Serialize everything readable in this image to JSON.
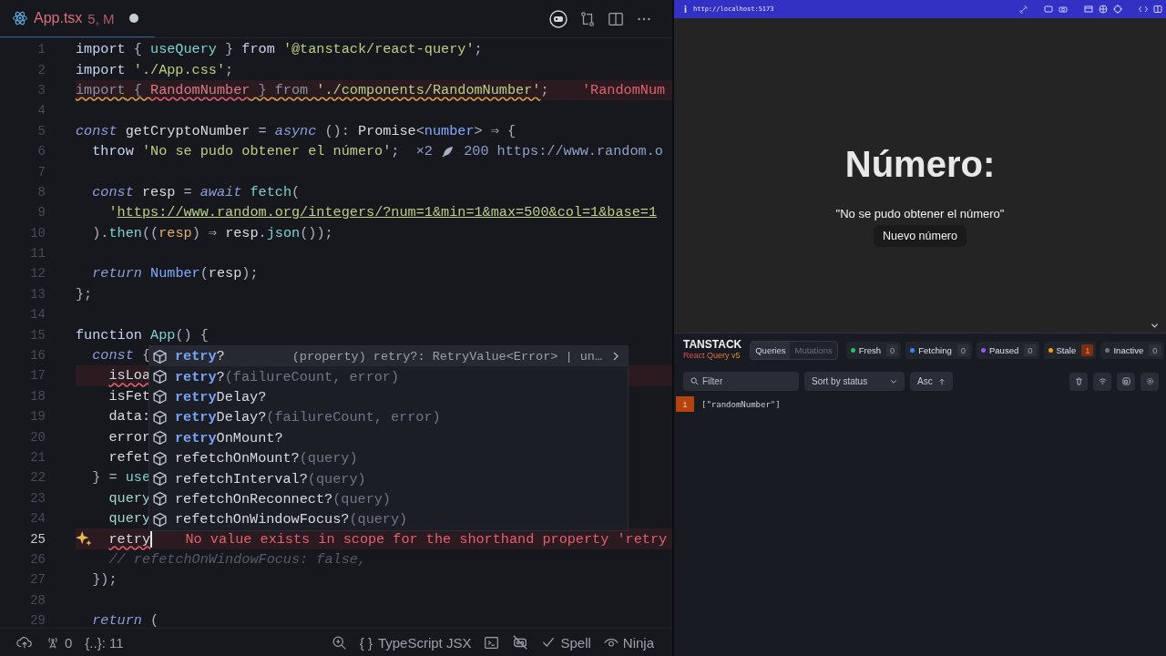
{
  "editor": {
    "tab": {
      "file": "App.tsx",
      "status": "5, M",
      "modified": true
    },
    "lines": [
      {
        "n": "1",
        "tokens": [
          {
            "t": "import",
            "kind": "kw"
          },
          {
            "t": " { ",
            "kind": "p"
          },
          {
            "t": "useQuery",
            "kind": "fn"
          },
          {
            "t": " } ",
            "kind": "p"
          },
          {
            "t": "from",
            "kind": "kw"
          },
          {
            "t": " '@tanstack/react-query'",
            "kind": "str"
          },
          {
            "t": ";",
            "kind": "p"
          }
        ]
      },
      {
        "n": "2",
        "tokens": [
          {
            "t": "import",
            "kind": "kw"
          },
          {
            "t": " './App.css'",
            "kind": "str"
          },
          {
            "t": ";",
            "kind": "p"
          }
        ]
      },
      {
        "n": "3",
        "error": true,
        "tokens": [
          {
            "t": "import",
            "kind": "dim",
            "warning": true,
            "error": false
          },
          {
            "t": " { ",
            "kind": "dim",
            "warning": true,
            "error": false
          },
          {
            "t": "RandomNumber",
            "kind": "err",
            "warning": false,
            "error": true
          },
          {
            "t": " } ",
            "kind": "dim",
            "warning": true,
            "error": false
          },
          {
            "t": "from",
            "kind": "dim",
            "warning": true,
            "error": false
          },
          {
            "t": " './components/RandomNumber'",
            "kind": "str",
            "warning": true,
            "error": false
          },
          {
            "t": ";",
            "kind": "p",
            "warning": false,
            "error": false
          }
        ],
        "hints": [
          {
            "kind": "error",
            "t": "'RandomNum"
          }
        ]
      },
      {
        "n": "4"
      },
      {
        "n": "5",
        "tokens": [
          {
            "t": "const",
            "kind": "it"
          },
          {
            "t": " getCryptoNumber ",
            "kind": "id"
          },
          {
            "t": "= ",
            "kind": "p"
          },
          {
            "t": "async",
            "kind": "it"
          },
          {
            "t": " (): ",
            "kind": "p"
          },
          {
            "t": "Promise",
            "kind": "id"
          },
          {
            "t": "<",
            "kind": "p"
          },
          {
            "t": "number",
            "kind": "ty"
          },
          {
            "t": "> ⇒ {",
            "kind": "p"
          }
        ]
      },
      {
        "n": "6",
        "tokens": [
          {
            "t": "  throw",
            "kind": "kw"
          },
          {
            "t": " 'No se pudo obtener el número'",
            "kind": "str"
          },
          {
            "t": ";",
            "kind": "p"
          }
        ],
        "hints": [
          {
            "kind": "info",
            "t": "×2"
          },
          {
            "kind": "icon"
          },
          {
            "kind": "info",
            "t": "200 https://www.random.o"
          }
        ]
      },
      {
        "n": "7"
      },
      {
        "n": "8",
        "tokens": [
          {
            "t": "  const",
            "kind": "it"
          },
          {
            "t": " resp ",
            "kind": "id"
          },
          {
            "t": "= ",
            "kind": "p"
          },
          {
            "t": "await",
            "kind": "it"
          },
          {
            "t": " fetch",
            "kind": "fn"
          },
          {
            "t": "(",
            "kind": "p"
          }
        ]
      },
      {
        "n": "9",
        "tokens": [
          {
            "t": "    '",
            "kind": "str"
          },
          {
            "t": "https://www.random.org/integers/?num=1&min=1&max=500&col=1&base=1",
            "kind": "url"
          }
        ]
      },
      {
        "n": "10",
        "tokens": [
          {
            "t": "  ).",
            "kind": "p"
          },
          {
            "t": "then",
            "kind": "fn"
          },
          {
            "t": "((",
            "kind": "p"
          },
          {
            "t": "resp",
            "kind": "par"
          },
          {
            "t": ") ⇒ ",
            "kind": "p"
          },
          {
            "t": "resp",
            "kind": "id"
          },
          {
            "t": ".",
            "kind": "p"
          },
          {
            "t": "json",
            "kind": "fn"
          },
          {
            "t": "());",
            "kind": "p"
          }
        ]
      },
      {
        "n": "11"
      },
      {
        "n": "12",
        "tokens": [
          {
            "t": "  return",
            "kind": "it"
          },
          {
            "t": " Number",
            "kind": "ty"
          },
          {
            "t": "(",
            "kind": "p"
          },
          {
            "t": "resp",
            "kind": "id"
          },
          {
            "t": ");",
            "kind": "p"
          }
        ]
      },
      {
        "n": "13",
        "tokens": [
          {
            "t": "};",
            "kind": "p"
          }
        ]
      },
      {
        "n": "14"
      },
      {
        "n": "15",
        "tokens": [
          {
            "t": "function",
            "kind": "kw"
          },
          {
            "t": " App",
            "kind": "fn"
          },
          {
            "t": "() {",
            "kind": "p"
          }
        ]
      },
      {
        "n": "16",
        "tokens": [
          {
            "t": "  const",
            "kind": "it"
          },
          {
            "t": " {",
            "kind": "p"
          }
        ]
      },
      {
        "n": "17",
        "error": true,
        "tokens": [
          {
            "t": "    isLoa",
            "kind": "id",
            "error": true
          }
        ]
      },
      {
        "n": "18",
        "tokens": [
          {
            "t": "    isFet",
            "kind": "id"
          }
        ]
      },
      {
        "n": "19",
        "tokens": [
          {
            "t": "    data:",
            "kind": "id"
          }
        ]
      },
      {
        "n": "20",
        "tokens": [
          {
            "t": "    error",
            "kind": "id"
          }
        ]
      },
      {
        "n": "21",
        "tokens": [
          {
            "t": "    refet",
            "kind": "id"
          }
        ]
      },
      {
        "n": "22",
        "tokens": [
          {
            "t": "  } = ",
            "kind": "p"
          },
          {
            "t": "use",
            "kind": "fn"
          }
        ]
      },
      {
        "n": "23",
        "tokens": [
          {
            "t": "    query",
            "kind": "prop"
          }
        ]
      },
      {
        "n": "24",
        "tokens": [
          {
            "t": "    query",
            "kind": "prop"
          }
        ]
      },
      {
        "n": "25",
        "active": true,
        "error": true,
        "lightbulb": true,
        "cursor": true,
        "tokens": [
          {
            "t": "    retry",
            "kind": "id",
            "error": true
          }
        ],
        "hints": [
          {
            "kind": "error",
            "t": "No value exists in scope for the shorthand property 'retry"
          }
        ]
      },
      {
        "n": "26",
        "tokens": [
          {
            "t": "    // refetchOnWindowFocus: false,",
            "kind": "cm"
          }
        ]
      },
      {
        "n": "27",
        "tokens": [
          {
            "t": "  });",
            "kind": "p"
          }
        ]
      },
      {
        "n": "28"
      },
      {
        "n": "29",
        "tokens": [
          {
            "t": "  return",
            "kind": "it"
          },
          {
            "t": " (",
            "kind": "p"
          }
        ]
      }
    ],
    "suggestions": [
      {
        "match": "retry",
        "rest": "?",
        "selected": true,
        "detail": "(property) retry?: RetryValue<Error> | un…"
      },
      {
        "match": "retry",
        "rest": "?",
        "params": "(failureCount, error)",
        "selected": false
      },
      {
        "match": "retry",
        "rest": "Delay?",
        "selected": false
      },
      {
        "match": "retry",
        "rest": "Delay?",
        "params": "(failureCount, error)",
        "selected": false
      },
      {
        "match": "retry",
        "rest": "OnMount?",
        "selected": false
      },
      {
        "rest": "refetchOnMount?",
        "params": "(query)",
        "selected": false
      },
      {
        "rest": "refetchInterval?",
        "params": "(query)",
        "selected": false
      },
      {
        "rest": "refetchOnReconnect?",
        "params": "(query)",
        "selected": false
      },
      {
        "rest": "refetchOnWindowFocus?",
        "params": "(query)",
        "selected": false
      }
    ]
  },
  "status_bar": {
    "ports": "0",
    "position": "{..}: 11",
    "braces": "{ }",
    "language": "TypeScript JSX",
    "spell": "Spell",
    "profile": "Ninja"
  },
  "browser": {
    "url": "http://localhost:5173"
  },
  "app": {
    "heading": "Número:",
    "message": "\"No se pudo obtener el número\"",
    "button": "Nuevo número"
  },
  "devtools": {
    "brand": "TANSTACK",
    "subtitle": "React Query v5",
    "tabs": [
      {
        "label": "Queries",
        "selected": true
      },
      {
        "label": "Mutations",
        "selected": false
      }
    ],
    "chips": [
      {
        "label": "Fresh",
        "count": "0",
        "color": "#22c55e",
        "highlighted": false
      },
      {
        "label": "Fetching",
        "count": "0",
        "color": "#3b82f6",
        "highlighted": false
      },
      {
        "label": "Paused",
        "count": "0",
        "color": "#8b5cf6",
        "highlighted": false
      },
      {
        "label": "Stale",
        "count": "1",
        "color": "#f59e0b",
        "highlighted": true
      },
      {
        "label": "Inactive",
        "count": "0",
        "color": "#6b7280",
        "highlighted": false
      }
    ],
    "filter": {
      "placeholder": "Filter"
    },
    "sort": "Sort by status",
    "order": "Asc",
    "queries": [
      {
        "count": "1",
        "key": "[\"randomNumber\"]",
        "color": "#b4430f"
      }
    ]
  }
}
